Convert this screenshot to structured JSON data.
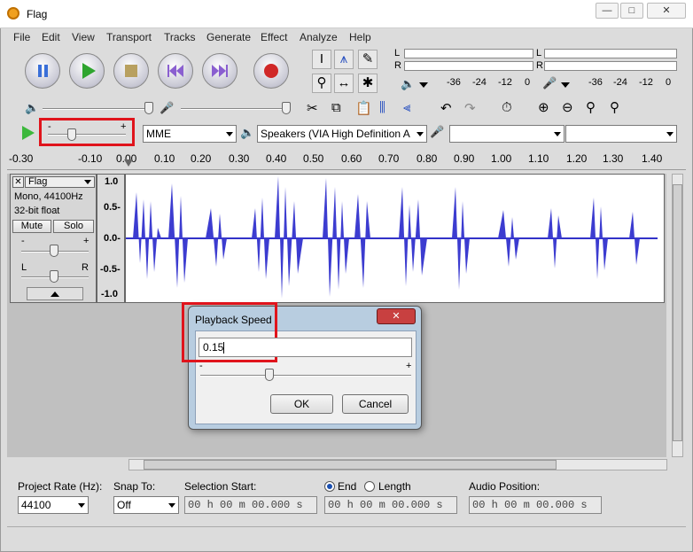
{
  "window": {
    "title": "Flag",
    "min": "—",
    "max": "□",
    "close": "✕"
  },
  "menu": [
    "File",
    "Edit",
    "View",
    "Transport",
    "Tracks",
    "Generate",
    "Effect",
    "Analyze",
    "Help"
  ],
  "meter": {
    "L": "L",
    "R": "R",
    "ticks_rec": [
      "-36",
      "-24",
      "-12",
      "0"
    ],
    "ticks_play": [
      "-36",
      "-24",
      "-12",
      "0"
    ]
  },
  "device": {
    "host": "MME",
    "output": "Speakers (VIA High Definition A",
    "input": "",
    "channels": ""
  },
  "ruler": [
    "-0.30",
    "-0.10",
    "0.00",
    "0.10",
    "0.20",
    "0.30",
    "0.40",
    "0.50",
    "0.60",
    "0.70",
    "0.80",
    "0.90",
    "1.00",
    "1.10",
    "1.20",
    "1.30",
    "1.40"
  ],
  "track": {
    "name": "Flag",
    "format1": "Mono, 44100Hz",
    "format2": "32-bit float",
    "mute": "Mute",
    "solo": "Solo",
    "gain_minus": "-",
    "gain_plus": "+",
    "pan_l": "L",
    "pan_r": "R"
  },
  "vruler": [
    "1.0",
    "0.5-",
    "0.0-",
    "-0.5-",
    "-1.0"
  ],
  "dialog": {
    "title": "Playback Speed",
    "value": "0.15",
    "minus": "-",
    "plus": "+",
    "ok": "OK",
    "cancel": "Cancel",
    "close": "✕"
  },
  "speed_slider": {
    "minus": "-",
    "plus": "+"
  },
  "status": {
    "project_rate_label": "Project Rate (Hz):",
    "project_rate": "44100",
    "snap_label": "Snap To:",
    "snap": "Off",
    "sel_start_label": "Selection Start:",
    "sel_start": "00 h 00 m 00.000 s",
    "end_label": "End",
    "length_label": "Length",
    "sel_end": "00 h 00 m 00.000 s",
    "audio_pos_label": "Audio Position:",
    "audio_pos": "00 h 00 m 00.000 s"
  }
}
